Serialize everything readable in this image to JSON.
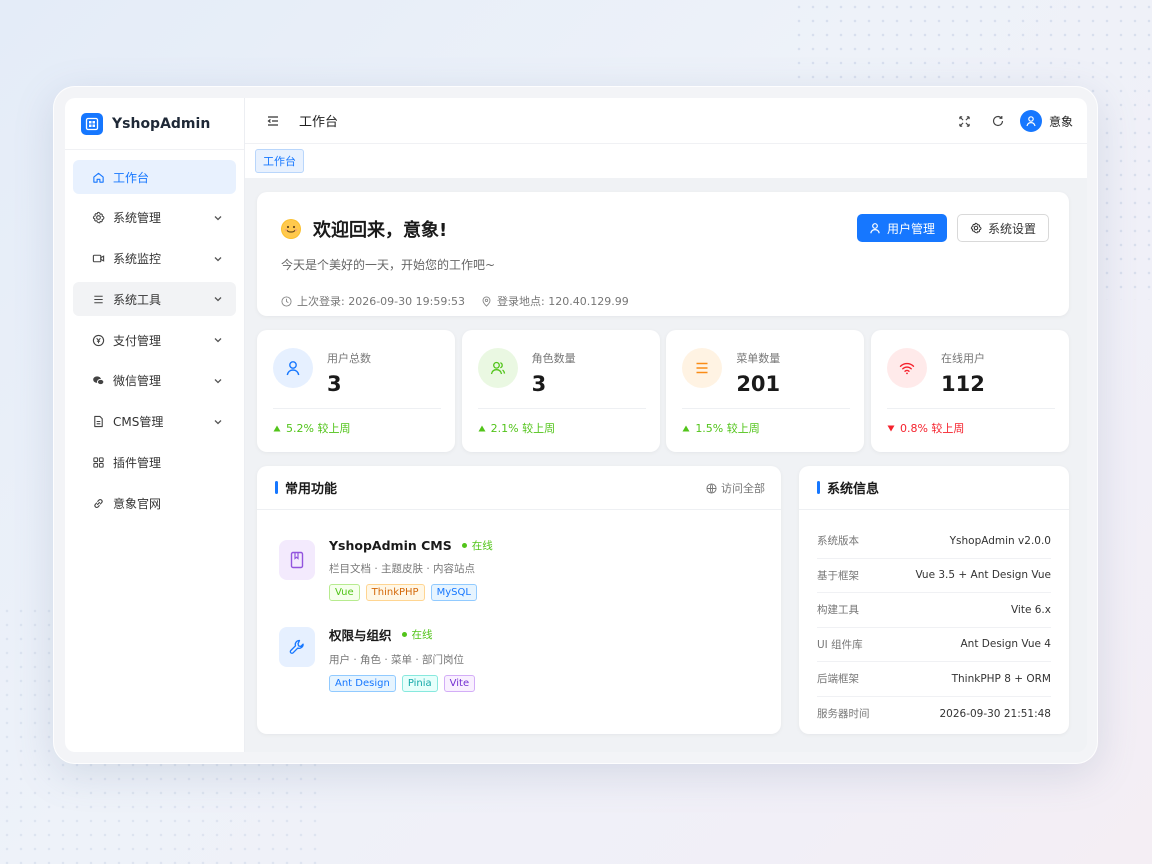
{
  "brand": {
    "name": "YshopAdmin"
  },
  "sidebar": {
    "items": [
      {
        "label": "工作台",
        "icon": "home-icon"
      },
      {
        "label": "系统管理",
        "icon": "gear-icon"
      },
      {
        "label": "系统监控",
        "icon": "video-icon"
      },
      {
        "label": "系统工具",
        "icon": "menu-lines-icon"
      },
      {
        "label": "支付管理",
        "icon": "yen-icon"
      },
      {
        "label": "微信管理",
        "icon": "wechat-icon"
      },
      {
        "label": "CMS管理",
        "icon": "document-icon"
      },
      {
        "label": "插件管理",
        "icon": "grid-icon"
      },
      {
        "label": "意象官网",
        "icon": "link-icon"
      }
    ]
  },
  "topbar": {
    "title": "工作台",
    "username": "意象"
  },
  "tags": {
    "active": "工作台"
  },
  "welcome": {
    "title": "欢迎回来，意象!",
    "subtitle": "今天是个美好的一天，开始您的工作吧~",
    "last_login": "上次登录: 2026-09-30 19:59:53",
    "location": "登录地点: 120.40.129.99",
    "btn_users": "用户管理",
    "btn_settings": "系统设置"
  },
  "stats": [
    {
      "label": "用户总数",
      "value": "3",
      "trend": "5.2% 较上周",
      "direction": "up",
      "color": "#1677ff"
    },
    {
      "label": "角色数量",
      "value": "3",
      "trend": "2.1% 较上周",
      "direction": "up",
      "color": "#52c41a"
    },
    {
      "label": "菜单数量",
      "value": "201",
      "trend": "1.5% 较上周",
      "direction": "up",
      "color": "#fa8c16"
    },
    {
      "label": "在线用户",
      "value": "112",
      "trend": "0.8% 较上周",
      "direction": "down",
      "color": "#f5222d"
    }
  ],
  "favorites": {
    "title": "常用功能",
    "link": "访问全部",
    "items": [
      {
        "name": "YshopAdmin CMS",
        "status": "在线",
        "desc": "栏目文档 · 主题皮肤 · 内容站点",
        "tags": [
          "Vue",
          "ThinkPHP",
          "MySQL"
        ]
      },
      {
        "name": "权限与组织",
        "status": "在线",
        "desc": "用户 · 角色 · 菜单 · 部门岗位",
        "tags": [
          "Ant Design",
          "Pinia",
          "Vite"
        ]
      }
    ]
  },
  "system": {
    "title": "系统信息",
    "rows": [
      {
        "k": "系统版本",
        "v": "YshopAdmin v2.0.0"
      },
      {
        "k": "基于框架",
        "v": "Vue 3.5 + Ant Design Vue"
      },
      {
        "k": "构建工具",
        "v": "Vite 6.x"
      },
      {
        "k": "UI 组件库",
        "v": "Ant Design Vue 4"
      },
      {
        "k": "后端框架",
        "v": "ThinkPHP 8 + ORM"
      },
      {
        "k": "服务器时间",
        "v": "2026-09-30 21:51:48"
      }
    ]
  }
}
